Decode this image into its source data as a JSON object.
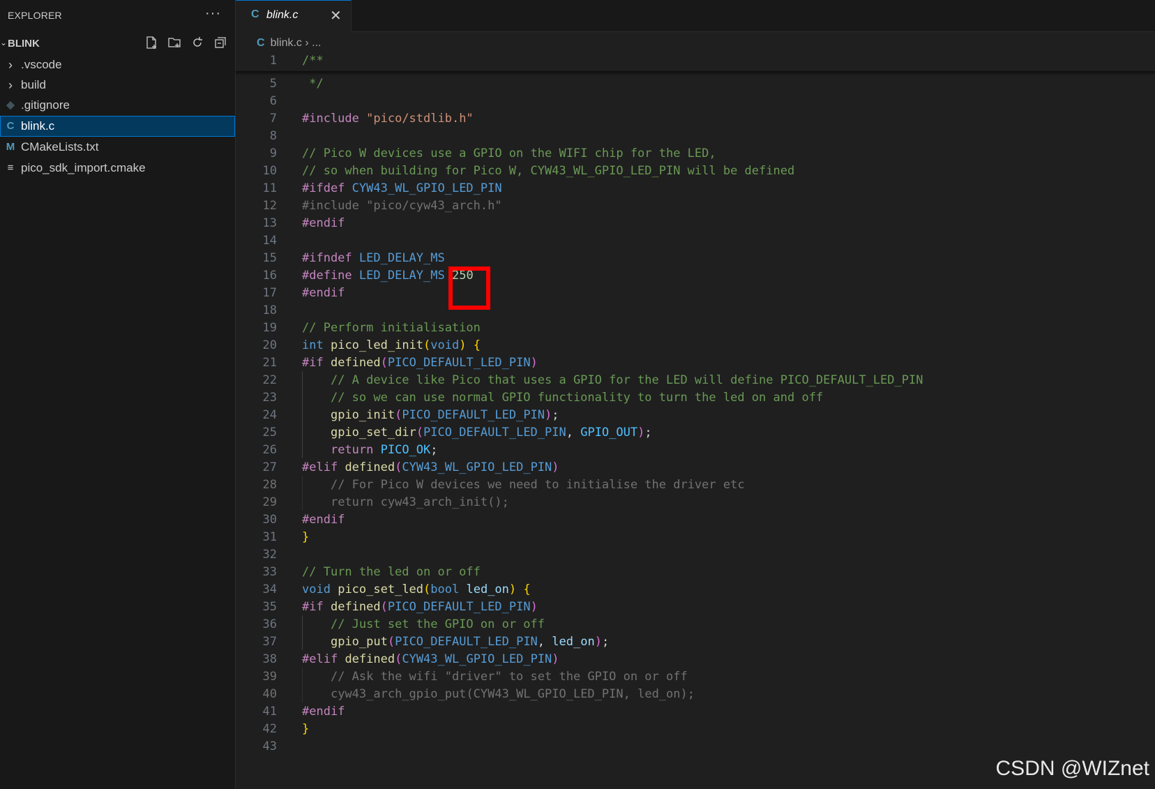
{
  "explorer": {
    "title": "EXPLORER",
    "more": "···",
    "folder": "BLINK",
    "items": [
      {
        "label": ".vscode",
        "icon": "chevron-right-icon",
        "glyph": "›"
      },
      {
        "label": "build",
        "icon": "chevron-right-icon",
        "glyph": "›"
      },
      {
        "label": ".gitignore",
        "icon": "git-icon",
        "glyph": "◆"
      },
      {
        "label": "blink.c",
        "icon": "c-file-icon",
        "glyph": "C",
        "selected": true
      },
      {
        "label": "CMakeLists.txt",
        "icon": "cmake-file-icon",
        "glyph": "M"
      },
      {
        "label": "pico_sdk_import.cmake",
        "icon": "lines-icon",
        "glyph": "≡"
      }
    ]
  },
  "tab": {
    "label": "blink.c",
    "icon_glyph": "C",
    "close": "✕"
  },
  "breadcrumb": {
    "file": "blink.c",
    "sep": "›",
    "more": "..."
  },
  "watermark": "CSDN @WIZnet",
  "colors": {
    "accent": "#0078d4",
    "highlight_box": "#ff0000"
  },
  "code_lines": [
    {
      "n": "1",
      "tokens": [
        [
          "tok-comment",
          "/**"
        ]
      ]
    },
    {
      "n": "5",
      "tokens": [
        [
          "tok-comment",
          " */"
        ]
      ]
    },
    {
      "n": "6",
      "tokens": []
    },
    {
      "n": "7",
      "tokens": [
        [
          "tok-pre",
          "#include"
        ],
        [
          "tok-punct",
          " "
        ],
        [
          "tok-str",
          "\"pico/stdlib.h\""
        ]
      ]
    },
    {
      "n": "8",
      "tokens": []
    },
    {
      "n": "9",
      "tokens": [
        [
          "tok-comment",
          "// Pico W devices use a GPIO on the WIFI chip for the LED,"
        ]
      ]
    },
    {
      "n": "10",
      "tokens": [
        [
          "tok-comment",
          "// so when building for Pico W, CYW43_WL_GPIO_LED_PIN will be defined"
        ]
      ]
    },
    {
      "n": "11",
      "tokens": [
        [
          "tok-pre",
          "#ifdef"
        ],
        [
          "tok-punct",
          " "
        ],
        [
          "tok-macro",
          "CYW43_WL_GPIO_LED_PIN"
        ]
      ]
    },
    {
      "n": "12",
      "inactive": true,
      "tokens": [
        [
          "tok-pre",
          "#include"
        ],
        [
          "tok-punct",
          " "
        ],
        [
          "tok-str",
          "\"pico/cyw43_arch.h\""
        ]
      ]
    },
    {
      "n": "13",
      "tokens": [
        [
          "tok-pre",
          "#endif"
        ]
      ]
    },
    {
      "n": "14",
      "tokens": []
    },
    {
      "n": "15",
      "tokens": [
        [
          "tok-pre",
          "#ifndef"
        ],
        [
          "tok-punct",
          " "
        ],
        [
          "tok-macro",
          "LED_DELAY_MS"
        ]
      ]
    },
    {
      "n": "16",
      "tokens": [
        [
          "tok-pre",
          "#define"
        ],
        [
          "tok-punct",
          " "
        ],
        [
          "tok-macro",
          "LED_DELAY_MS"
        ],
        [
          "tok-punct",
          " "
        ],
        [
          "tok-num",
          "250"
        ]
      ]
    },
    {
      "n": "17",
      "tokens": [
        [
          "tok-pre",
          "#endif"
        ]
      ]
    },
    {
      "n": "18",
      "tokens": []
    },
    {
      "n": "19",
      "tokens": [
        [
          "tok-comment",
          "// Perform initialisation"
        ]
      ]
    },
    {
      "n": "20",
      "tokens": [
        [
          "tok-type",
          "int"
        ],
        [
          "tok-punct",
          " "
        ],
        [
          "tok-fn",
          "pico_led_init"
        ],
        [
          "tok-brace",
          "("
        ],
        [
          "tok-type",
          "void"
        ],
        [
          "tok-brace",
          ")"
        ],
        [
          "tok-punct",
          " "
        ],
        [
          "tok-brace",
          "{"
        ]
      ]
    },
    {
      "n": "21",
      "tokens": [
        [
          "tok-pre",
          "#if"
        ],
        [
          "tok-punct",
          " "
        ],
        [
          "tok-fn",
          "defined"
        ],
        [
          "tok-paren",
          "("
        ],
        [
          "tok-macro",
          "PICO_DEFAULT_LED_PIN"
        ],
        [
          "tok-paren",
          ")"
        ]
      ]
    },
    {
      "n": "22",
      "guide": true,
      "tokens": [
        [
          "tok-punct",
          "    "
        ],
        [
          "tok-comment",
          "// A device like Pico that uses a GPIO for the LED will define PICO_DEFAULT_LED_PIN"
        ]
      ]
    },
    {
      "n": "23",
      "guide": true,
      "tokens": [
        [
          "tok-punct",
          "    "
        ],
        [
          "tok-comment",
          "// so we can use normal GPIO functionality to turn the led on and off"
        ]
      ]
    },
    {
      "n": "24",
      "guide": true,
      "tokens": [
        [
          "tok-punct",
          "    "
        ],
        [
          "tok-fn",
          "gpio_init"
        ],
        [
          "tok-paren",
          "("
        ],
        [
          "tok-macro",
          "PICO_DEFAULT_LED_PIN"
        ],
        [
          "tok-paren",
          ")"
        ],
        [
          "tok-punct",
          ";"
        ]
      ]
    },
    {
      "n": "25",
      "guide": true,
      "tokens": [
        [
          "tok-punct",
          "    "
        ],
        [
          "tok-fn",
          "gpio_set_dir"
        ],
        [
          "tok-paren",
          "("
        ],
        [
          "tok-macro",
          "PICO_DEFAULT_LED_PIN"
        ],
        [
          "tok-punct",
          ", "
        ],
        [
          "tok-const",
          "GPIO_OUT"
        ],
        [
          "tok-paren",
          ")"
        ],
        [
          "tok-punct",
          ";"
        ]
      ]
    },
    {
      "n": "26",
      "guide": true,
      "tokens": [
        [
          "tok-punct",
          "    "
        ],
        [
          "tok-kw",
          "return"
        ],
        [
          "tok-punct",
          " "
        ],
        [
          "tok-const",
          "PICO_OK"
        ],
        [
          "tok-punct",
          ";"
        ]
      ]
    },
    {
      "n": "27",
      "tokens": [
        [
          "tok-pre",
          "#elif"
        ],
        [
          "tok-punct",
          " "
        ],
        [
          "tok-fn",
          "defined"
        ],
        [
          "tok-paren",
          "("
        ],
        [
          "tok-macro",
          "CYW43_WL_GPIO_LED_PIN"
        ],
        [
          "tok-paren",
          ")"
        ]
      ]
    },
    {
      "n": "28",
      "guide": true,
      "inactive": true,
      "tokens": [
        [
          "tok-punct",
          "    "
        ],
        [
          "tok-comment",
          "// For Pico W devices we need to initialise the driver etc"
        ]
      ]
    },
    {
      "n": "29",
      "guide": true,
      "inactive": true,
      "tokens": [
        [
          "tok-punct",
          "    "
        ],
        [
          "tok-kw",
          "return"
        ],
        [
          "tok-punct",
          " "
        ],
        [
          "tok-fn",
          "cyw43_arch_init"
        ],
        [
          "tok-paren",
          "()"
        ],
        [
          "tok-punct",
          ";"
        ]
      ]
    },
    {
      "n": "30",
      "tokens": [
        [
          "tok-pre",
          "#endif"
        ]
      ]
    },
    {
      "n": "31",
      "tokens": [
        [
          "tok-brace",
          "}"
        ]
      ]
    },
    {
      "n": "32",
      "tokens": []
    },
    {
      "n": "33",
      "tokens": [
        [
          "tok-comment",
          "// Turn the led on or off"
        ]
      ]
    },
    {
      "n": "34",
      "tokens": [
        [
          "tok-type",
          "void"
        ],
        [
          "tok-punct",
          " "
        ],
        [
          "tok-fn",
          "pico_set_led"
        ],
        [
          "tok-brace",
          "("
        ],
        [
          "tok-type",
          "bool"
        ],
        [
          "tok-punct",
          " "
        ],
        [
          "tok-param",
          "led_on"
        ],
        [
          "tok-brace",
          ")"
        ],
        [
          "tok-punct",
          " "
        ],
        [
          "tok-brace",
          "{"
        ]
      ]
    },
    {
      "n": "35",
      "tokens": [
        [
          "tok-pre",
          "#if"
        ],
        [
          "tok-punct",
          " "
        ],
        [
          "tok-fn",
          "defined"
        ],
        [
          "tok-paren",
          "("
        ],
        [
          "tok-macro",
          "PICO_DEFAULT_LED_PIN"
        ],
        [
          "tok-paren",
          ")"
        ]
      ]
    },
    {
      "n": "36",
      "guide": true,
      "tokens": [
        [
          "tok-punct",
          "    "
        ],
        [
          "tok-comment",
          "// Just set the GPIO on or off"
        ]
      ]
    },
    {
      "n": "37",
      "guide": true,
      "tokens": [
        [
          "tok-punct",
          "    "
        ],
        [
          "tok-fn",
          "gpio_put"
        ],
        [
          "tok-paren",
          "("
        ],
        [
          "tok-macro",
          "PICO_DEFAULT_LED_PIN"
        ],
        [
          "tok-punct",
          ", "
        ],
        [
          "tok-param",
          "led_on"
        ],
        [
          "tok-paren",
          ")"
        ],
        [
          "tok-punct",
          ";"
        ]
      ]
    },
    {
      "n": "38",
      "tokens": [
        [
          "tok-pre",
          "#elif"
        ],
        [
          "tok-punct",
          " "
        ],
        [
          "tok-fn",
          "defined"
        ],
        [
          "tok-paren",
          "("
        ],
        [
          "tok-macro",
          "CYW43_WL_GPIO_LED_PIN"
        ],
        [
          "tok-paren",
          ")"
        ]
      ]
    },
    {
      "n": "39",
      "guide": true,
      "inactive": true,
      "tokens": [
        [
          "tok-punct",
          "    "
        ],
        [
          "tok-comment",
          "// Ask the wifi \"driver\" to set the GPIO on or off"
        ]
      ]
    },
    {
      "n": "40",
      "guide": true,
      "inactive": true,
      "tokens": [
        [
          "tok-punct",
          "    "
        ],
        [
          "tok-fn",
          "cyw43_arch_gpio_put"
        ],
        [
          "tok-paren",
          "("
        ],
        [
          "tok-macro",
          "CYW43_WL_GPIO_LED_PIN"
        ],
        [
          "tok-punct",
          ", "
        ],
        [
          "tok-param",
          "led_on"
        ],
        [
          "tok-paren",
          ")"
        ],
        [
          "tok-punct",
          ";"
        ]
      ]
    },
    {
      "n": "41",
      "tokens": [
        [
          "tok-pre",
          "#endif"
        ]
      ]
    },
    {
      "n": "42",
      "tokens": [
        [
          "tok-brace",
          "}"
        ]
      ]
    },
    {
      "n": "43",
      "tokens": []
    }
  ]
}
